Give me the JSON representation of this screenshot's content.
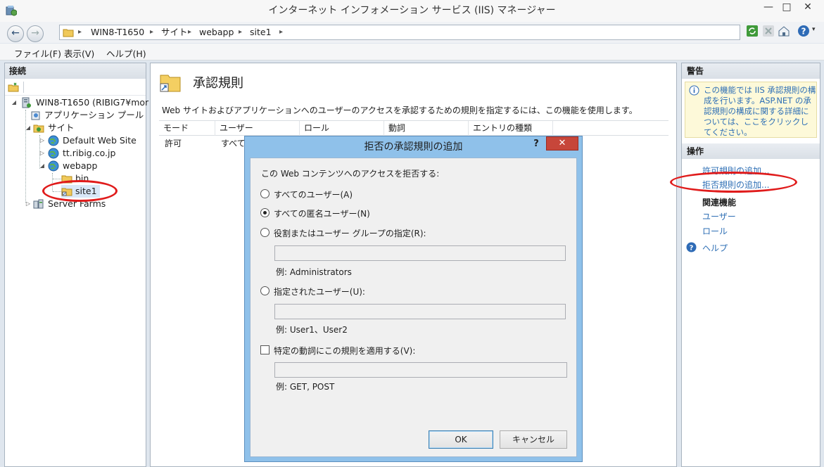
{
  "window": {
    "title": "インターネット インフォメーション サービス (IIS) マネージャー",
    "min": "—",
    "max": "□",
    "close": "✕"
  },
  "address": {
    "crumbs": [
      "WIN8-T1650",
      "サイト",
      "webapp",
      "site1"
    ],
    "sep": "▸"
  },
  "menu": [
    "ファイル(F)",
    "表示(V)",
    "ヘルプ(H)"
  ],
  "left": {
    "header": "接続",
    "tree": [
      {
        "label": "WIN8-T1650 (RIBIG7¥mor",
        "level": 0
      },
      {
        "label": "アプリケーション プール",
        "level": 1
      },
      {
        "label": "サイト",
        "level": 1
      },
      {
        "label": "Default Web Site",
        "level": 2
      },
      {
        "label": "tt.ribig.co.jp",
        "level": 2
      },
      {
        "label": "webapp",
        "level": 2
      },
      {
        "label": "bin",
        "level": 3
      },
      {
        "label": "site1",
        "level": 3
      },
      {
        "label": "Server Farms",
        "level": 1
      }
    ]
  },
  "center": {
    "title": "承認規則",
    "description": "Web サイトおよびアプリケーションへのユーザーのアクセスを承認するための規則を指定するには、この機能を使用します。",
    "columns": [
      "モード",
      "ユーザー",
      "ロール",
      "動詞",
      "エントリの種類"
    ],
    "rows": [
      [
        "許可",
        "すべての"
      ]
    ]
  },
  "right": {
    "alerts_header": "警告",
    "alert_text": "この機能では IIS 承認規則の構成を行います。ASP.NET の承認規則の構成に関する詳細については、ここをクリックしてください。",
    "actions_header": "操作",
    "add_allow": "許可規則の追加...",
    "add_deny": "拒否規則の追加...",
    "related_header": "関連機能",
    "users_link": "ユーザー",
    "roles_link": "ロール",
    "help_link": "ヘルプ"
  },
  "dialog": {
    "title": "拒否の承認規則の追加",
    "help": "?",
    "close": "✕",
    "prompt": "この Web コンテンツへのアクセスを拒否する:",
    "opt_all_users": "すべてのユーザー(A)",
    "opt_anonymous": "すべての匿名ユーザー(N)",
    "opt_roles": "役割またはユーザー グループの指定(R):",
    "roles_value": "",
    "roles_example": "例: Administrators",
    "opt_users": "指定されたユーザー(U):",
    "users_value": "",
    "users_example": "例: User1、User2",
    "verbs_check": "特定の動詞にこの規則を適用する(V):",
    "verbs_value": "",
    "verbs_example": "例: GET, POST",
    "ok": "OK",
    "cancel": "キャンセル"
  }
}
